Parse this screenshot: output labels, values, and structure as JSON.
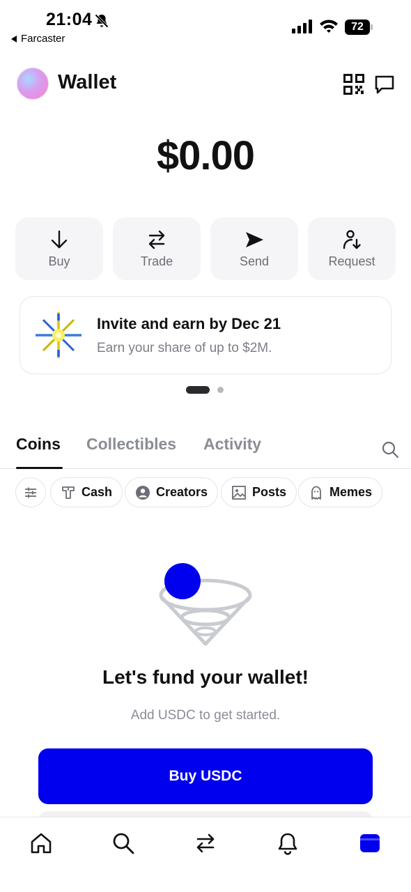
{
  "status_bar": {
    "time": "21:04",
    "battery": "72",
    "back_label": "Farcaster"
  },
  "header": {
    "title": "Wallet"
  },
  "balance": "$0.00",
  "actions": [
    {
      "label": "Buy",
      "icon": "arrow-down-icon"
    },
    {
      "label": "Trade",
      "icon": "swap-icon"
    },
    {
      "label": "Send",
      "icon": "send-icon"
    },
    {
      "label": "Request",
      "icon": "request-icon"
    }
  ],
  "promo": {
    "title": "Invite and earn by Dec 21",
    "subtitle": "Earn your share of up to $2M."
  },
  "carousel": {
    "active_index": 0,
    "count": 2
  },
  "tabs": [
    {
      "label": "Coins",
      "active": true
    },
    {
      "label": "Collectibles",
      "active": false
    },
    {
      "label": "Activity",
      "active": false
    }
  ],
  "chips": [
    {
      "label": "Cash",
      "icon": "shirt-icon"
    },
    {
      "label": "Creators",
      "icon": "user-circle-icon"
    },
    {
      "label": "Posts",
      "icon": "image-icon"
    },
    {
      "label": "Memes",
      "icon": "ghost-icon"
    }
  ],
  "empty_state": {
    "title": "Let's fund your wallet!",
    "subtitle": "Add USDC to get started.",
    "button_label": "Buy USDC"
  },
  "nav": [
    "home-icon",
    "search-icon",
    "swap-icon",
    "bell-icon",
    "wallet-icon"
  ],
  "colors": {
    "accent": "#0000ee",
    "muted_text": "#8a8d94",
    "chip_border": "#e4e4e8"
  }
}
